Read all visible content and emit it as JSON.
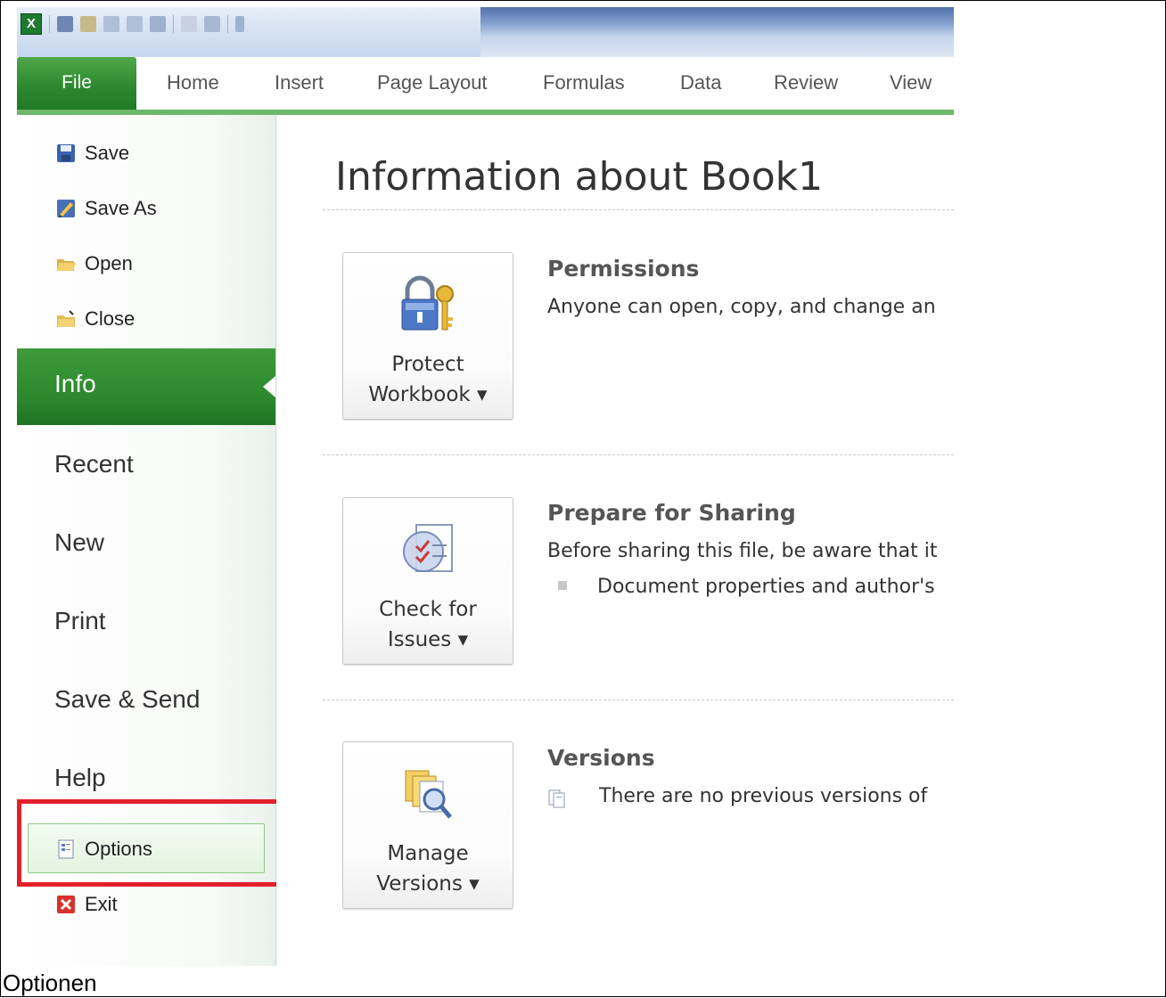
{
  "ribbon": {
    "tabs": [
      "File",
      "Home",
      "Insert",
      "Page Layout",
      "Formulas",
      "Data",
      "Review",
      "View"
    ]
  },
  "nav": {
    "small_top": [
      "Save",
      "Save As",
      "Open",
      "Close"
    ],
    "info": "Info",
    "large": [
      "Recent",
      "New",
      "Print",
      "Save & Send",
      "Help"
    ],
    "options": "Options",
    "exit": "Exit"
  },
  "main": {
    "title": "Information about Book1",
    "permissions": {
      "button_line1": "Protect",
      "button_line2": "Workbook ▾",
      "heading": "Permissions",
      "text": "Anyone can open, copy, and change an"
    },
    "prepare": {
      "button_line1": "Check for",
      "button_line2": "Issues ▾",
      "heading": "Prepare for Sharing",
      "text": "Before sharing this file, be aware that it",
      "bullet": "Document properties and author's"
    },
    "versions": {
      "button_line1": "Manage",
      "button_line2": "Versions ▾",
      "heading": "Versions",
      "text": "There are no previous versions of"
    }
  },
  "caption": "Optionen",
  "colors": {
    "accent_green": "#2d8a2e",
    "highlight_red": "#e3202a"
  }
}
